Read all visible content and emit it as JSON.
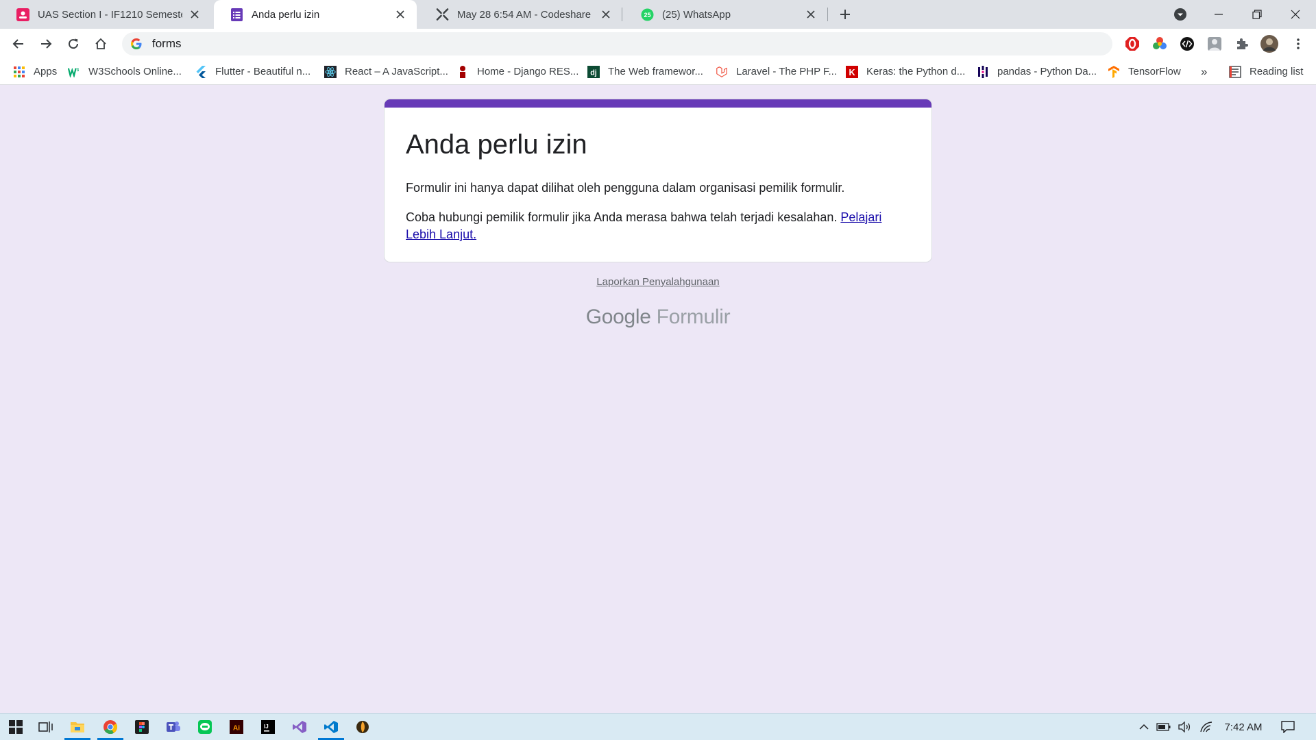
{
  "browser": {
    "tabs": [
      {
        "title": "UAS Section I - IF1210 Semester",
        "icon": "google-forms-pink-icon",
        "active": false
      },
      {
        "title": "Anda perlu izin",
        "icon": "google-forms-icon",
        "active": true
      },
      {
        "title": "May 28 6:54 AM - Codeshare",
        "icon": "codeshare-icon",
        "active": false
      },
      {
        "title": "(25) WhatsApp",
        "icon": "whatsapp-icon",
        "active": false
      }
    ],
    "whatsapp_badge": "25",
    "address": "forms",
    "bookmarks": [
      {
        "label": "Apps",
        "icon": "apps-grid-icon"
      },
      {
        "label": "W3Schools Online...",
        "icon": "w3schools-icon"
      },
      {
        "label": "Flutter - Beautiful n...",
        "icon": "flutter-icon"
      },
      {
        "label": "React – A JavaScript...",
        "icon": "react-icon"
      },
      {
        "label": "Home - Django RES...",
        "icon": "django-rest-icon"
      },
      {
        "label": "The Web framewor...",
        "icon": "django-icon"
      },
      {
        "label": "Laravel - The PHP F...",
        "icon": "laravel-icon"
      },
      {
        "label": "Keras: the Python d...",
        "icon": "keras-icon"
      },
      {
        "label": "pandas - Python Da...",
        "icon": "pandas-icon"
      },
      {
        "label": "TensorFlow",
        "icon": "tensorflow-icon"
      }
    ],
    "bookmarks_more": "»",
    "reading_list": "Reading list",
    "django_glyph": "dj",
    "keras_glyph": "K"
  },
  "page": {
    "title": "Anda perlu izin",
    "message1": "Formulir ini hanya dapat dilihat oleh pengguna dalam organisasi pemilik formulir.",
    "message2": "Coba hubungi pemilik formulir jika Anda merasa bahwa telah terjadi kesalahan.",
    "learn_more": "Pelajari Lebih Lanjut.",
    "report_abuse": "Laporkan Penyalahgunaan",
    "brand_google": "Google",
    "brand_product": "Formulir",
    "accent_color": "#673ab7",
    "background_color": "#ede7f6"
  },
  "taskbar": {
    "clock": "7:42 AM",
    "apps": [
      "start-icon",
      "task-view-icon",
      "file-explorer-icon",
      "chrome-icon",
      "figma-icon",
      "teams-icon",
      "line-icon",
      "illustrator-icon",
      "intellij-icon",
      "visual-studio-icon",
      "vscode-icon",
      "fl-studio-icon"
    ],
    "illustrator_glyph": "Ai",
    "intellij_glyph": "IJ"
  }
}
